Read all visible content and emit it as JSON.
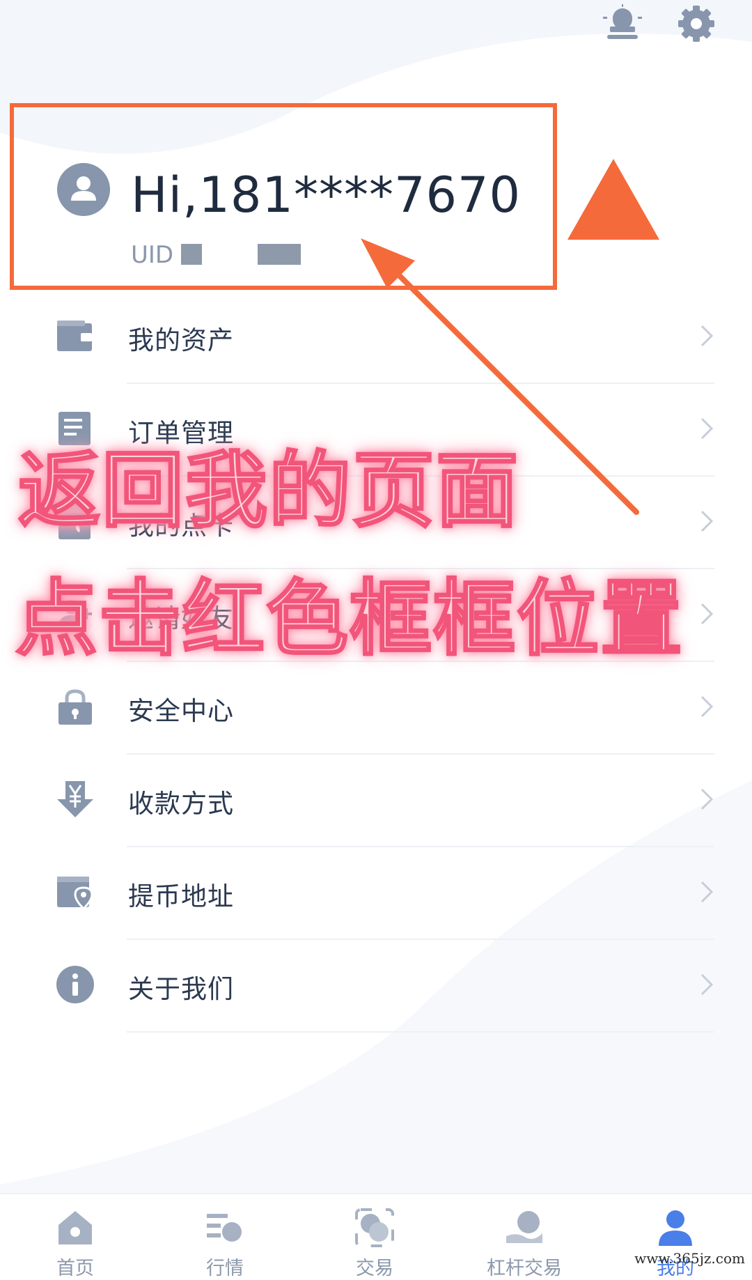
{
  "profile": {
    "greeting": "Hi,181****7670",
    "uid_label": "UID"
  },
  "menu": {
    "items": [
      {
        "label": "我的资产",
        "icon": "wallet-icon"
      },
      {
        "label": "订单管理",
        "icon": "order-list-icon"
      },
      {
        "label": "我的点卡",
        "icon": "point-card-icon"
      },
      {
        "label": "邀请好友",
        "icon": "invite-friends-icon"
      },
      {
        "label": "安全中心",
        "icon": "lock-icon"
      },
      {
        "label": "收款方式",
        "icon": "yuan-download-icon"
      },
      {
        "label": "提币地址",
        "icon": "location-card-icon"
      },
      {
        "label": "关于我们",
        "icon": "info-icon"
      }
    ]
  },
  "overlay": {
    "line1": "返回我的页面",
    "line2": "点击红色框框位置"
  },
  "tabbar": {
    "tabs": [
      {
        "label": "首页",
        "icon": "home-icon"
      },
      {
        "label": "行情",
        "icon": "market-icon"
      },
      {
        "label": "交易",
        "icon": "trade-icon"
      },
      {
        "label": "杠杆交易",
        "icon": "leverage-icon"
      },
      {
        "label": "我的",
        "icon": "user-icon",
        "active": true
      }
    ]
  },
  "watermark": "www.365jz.com",
  "colors": {
    "highlight": "#f56a3a",
    "icon_gray": "#8796ac",
    "active_tab": "#4a7ee8",
    "overlay_text": "#ffd3dc"
  }
}
